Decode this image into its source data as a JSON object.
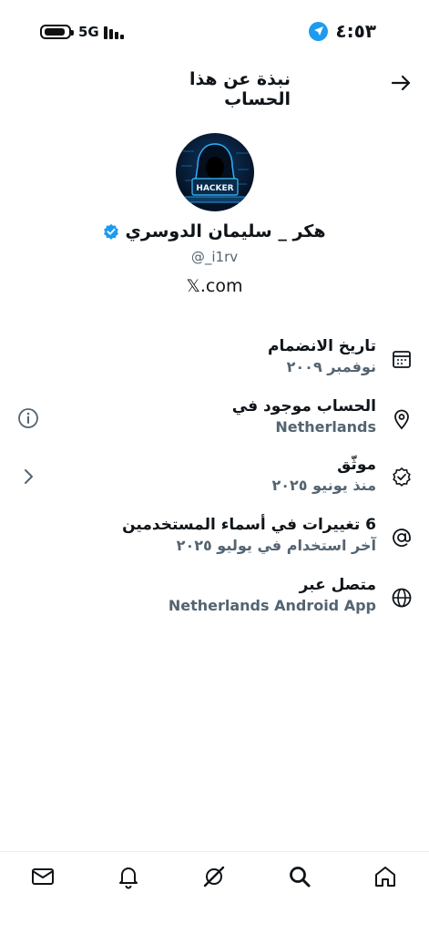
{
  "status": {
    "network": "5G",
    "time": "٤:٥٣"
  },
  "header": {
    "title": "نبذة عن هذا الحساب"
  },
  "profile": {
    "avatar_text": "HACKER",
    "name": "هكر _ سليمان الدوسري",
    "handle": "@_i1rv",
    "site": "𝕏.com"
  },
  "info": [
    {
      "label": "تاريخ الانضمام",
      "value": "نوفمبر ٢٠٠٩",
      "icon": "calendar-icon"
    },
    {
      "label": "الحساب موجود في",
      "value": "Netherlands",
      "icon": "location-pin-icon",
      "side": "info-icon"
    },
    {
      "label": "موثّق",
      "value": "منذ يونيو ٢٠٢٥",
      "icon": "verified-badge-icon",
      "side": "chevron-icon"
    },
    {
      "label": "6 تغييرات في أسماء المستخدمين",
      "value": "آخر استخدام في يوليو ٢٠٢٥",
      "icon": "at-sign-icon"
    },
    {
      "label": "متصل عبر",
      "value": "Netherlands Android App",
      "icon": "globe-icon"
    }
  ],
  "colors": {
    "accent": "#1d9bf0",
    "secondary_text": "#536471",
    "primary_text": "#0f1419"
  },
  "nav": [
    "messages-icon",
    "notifications-icon",
    "grok-icon",
    "search-icon",
    "home-icon"
  ]
}
